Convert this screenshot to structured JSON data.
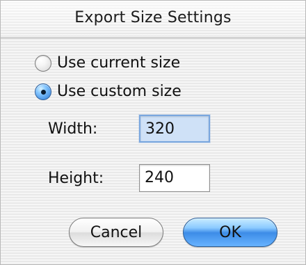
{
  "dialog": {
    "title": "Export Size Settings"
  },
  "options": {
    "use_current_size": "Use current size",
    "use_custom_size": "Use custom size"
  },
  "fields": {
    "width_label": "Width:",
    "width_value": "320",
    "height_label": "Height:",
    "height_value": "240"
  },
  "buttons": {
    "cancel": "Cancel",
    "ok": "OK"
  },
  "icons": {
    "radio_unchecked": "radio-unchecked-icon",
    "radio_checked": "radio-checked-icon"
  }
}
